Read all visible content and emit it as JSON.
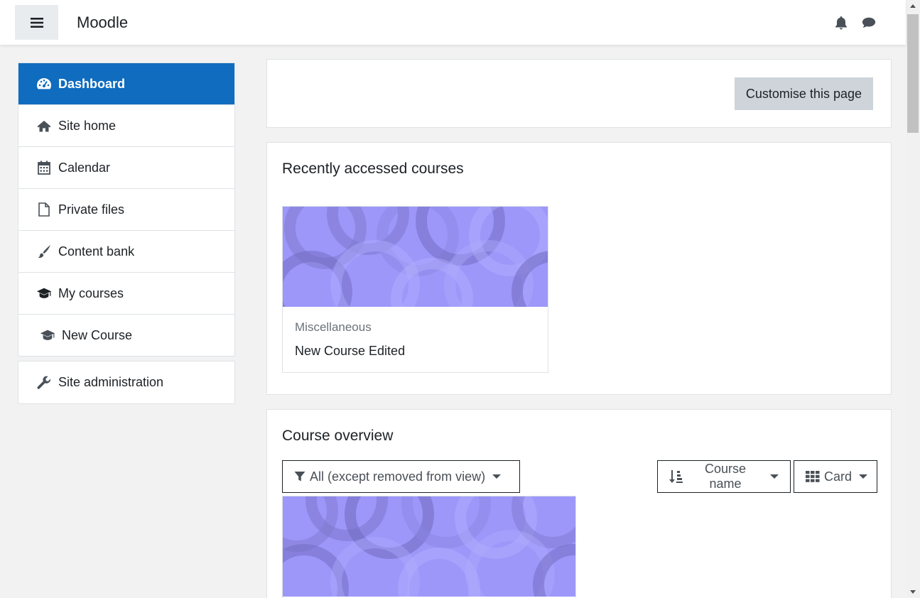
{
  "app": {
    "brand": "Moodle"
  },
  "header": {
    "menu_icon": "hamburger-icon",
    "notifications_icon": "bell-icon",
    "messages_icon": "chat-bubble-icon"
  },
  "drawer": {
    "items": [
      {
        "label": "Dashboard",
        "icon": "gauge-icon",
        "active": true
      },
      {
        "label": "Site home",
        "icon": "home-icon"
      },
      {
        "label": "Calendar",
        "icon": "calendar-icon"
      },
      {
        "label": "Private files",
        "icon": "file-icon"
      },
      {
        "label": "Content bank",
        "icon": "brush-icon"
      },
      {
        "label": "My courses",
        "icon": "graduation-cap-icon"
      },
      {
        "label": "New Course",
        "icon": "graduation-cap-icon"
      }
    ],
    "admin": {
      "label": "Site administration",
      "icon": "wrench-icon"
    }
  },
  "page": {
    "customise_label": "Customise this page"
  },
  "recent": {
    "title": "Recently accessed courses",
    "course": {
      "category": "Miscellaneous",
      "name": "New Course Edited"
    }
  },
  "overview": {
    "title": "Course overview",
    "filter_label": "All (except removed from view)",
    "sort_label": "Course name",
    "view_label": "Card"
  },
  "colors": {
    "brand_blue": "#0f6cbf",
    "course_image": "#9d97f9",
    "button_grey": "#ced4da"
  }
}
